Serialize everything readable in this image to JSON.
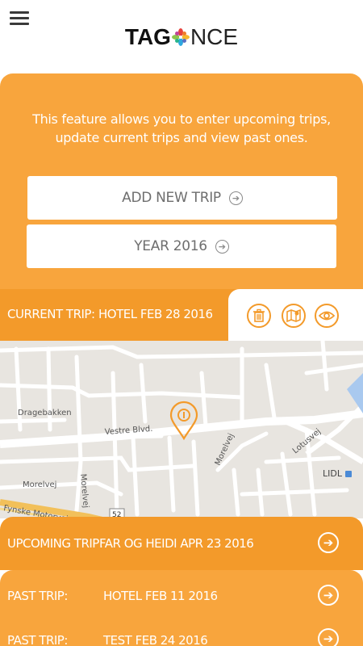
{
  "header": {
    "logo_left": "TAG",
    "logo_right": "NCE",
    "menu_icon": "hamburger-menu-icon"
  },
  "intro": {
    "text": "This feature allows you to enter upcoming trips, update current trips and view past ones."
  },
  "buttons": {
    "add_new_trip": "ADD NEW TRIP",
    "year": "YEAR 2016"
  },
  "current_trip": {
    "label": "CURRENT TRIP:",
    "value": "HOTEL FEB 28 2016",
    "icons": [
      "trash-icon",
      "map-icon",
      "eye-icon"
    ]
  },
  "map": {
    "streets": [
      "Dragebakken",
      "Vestre Blvd.",
      "Morelvej",
      "Morelvej",
      "Lotusvej",
      "Morelvej",
      "Fynske Motorvej"
    ],
    "road_number": "52",
    "store": "LIDL"
  },
  "upcoming_trip": {
    "label": "UPCOMING TRIP:",
    "value": "FAR OG HEIDI APR 23 2016"
  },
  "past_trips": [
    {
      "label": "PAST TRIP:",
      "value": "HOTEL FEB 11 2016"
    },
    {
      "label": "PAST TRIP:",
      "value": "TEST FEB 24 2016"
    }
  ],
  "colors": {
    "primary_orange": "#f8a53d",
    "dark_orange": "#f39a2a",
    "map_bg": "#e6e3df"
  }
}
